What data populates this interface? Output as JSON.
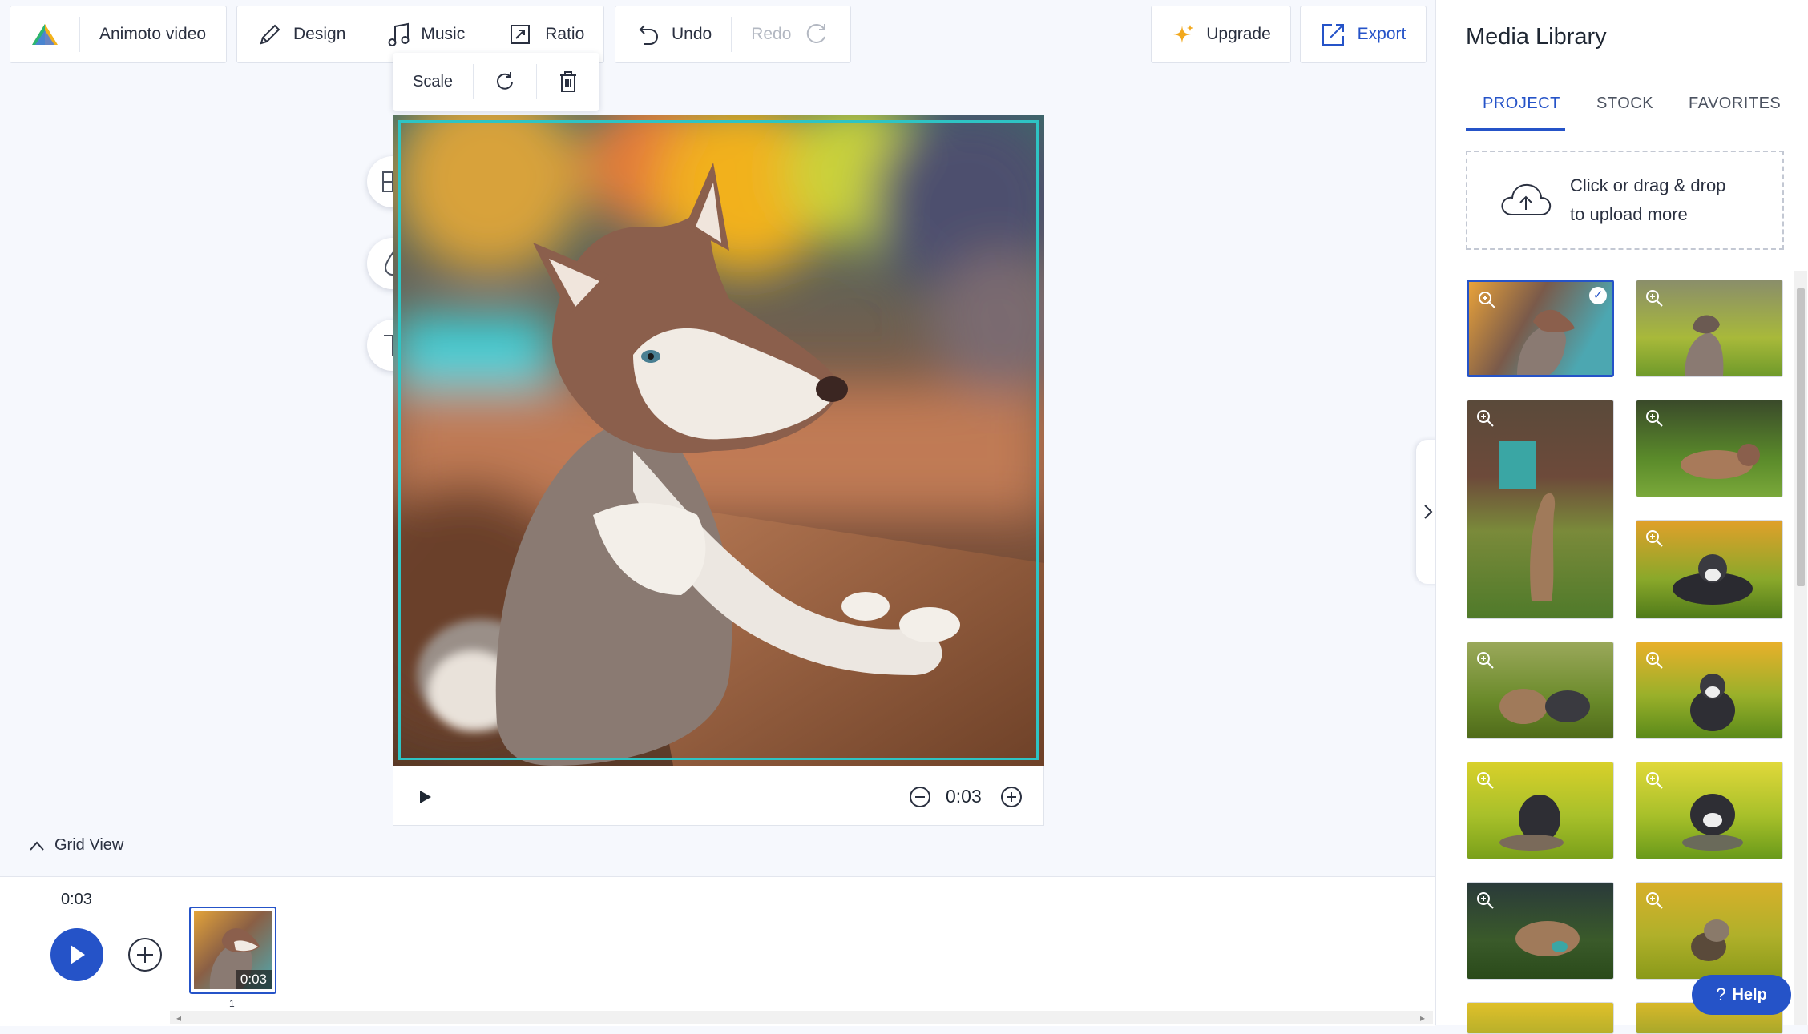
{
  "app": {
    "title": "Animoto video",
    "logo_icon": "animoto-logo-icon"
  },
  "toolbar": {
    "design_label": "Design",
    "music_label": "Music",
    "ratio_label": "Ratio",
    "undo_label": "Undo",
    "redo_label": "Redo",
    "upgrade_label": "Upgrade",
    "export_label": "Export"
  },
  "context_menu": {
    "scale_label": "Scale",
    "rotate_icon": "rotate-icon",
    "delete_icon": "trash-icon"
  },
  "side_tools": [
    "layout-icon",
    "color-drop-icon",
    "text-icon"
  ],
  "player": {
    "duration": "0:03"
  },
  "grid_view": {
    "label": "Grid View"
  },
  "timeline": {
    "total_time": "0:03",
    "clips": [
      {
        "duration": "0:03",
        "index": "1"
      }
    ]
  },
  "media_library": {
    "title": "Media Library",
    "tabs": [
      {
        "label": "PROJECT",
        "active": true
      },
      {
        "label": "STOCK",
        "active": false
      },
      {
        "label": "FAVORITES",
        "active": false
      }
    ],
    "upload_line1": "Click or drag & drop",
    "upload_line2": "to upload more",
    "items_visible": 12
  },
  "help": {
    "label": "Help"
  },
  "colors": {
    "accent": "#2553c8",
    "selection": "#2ec4c4",
    "background": "#f6f8fd"
  }
}
